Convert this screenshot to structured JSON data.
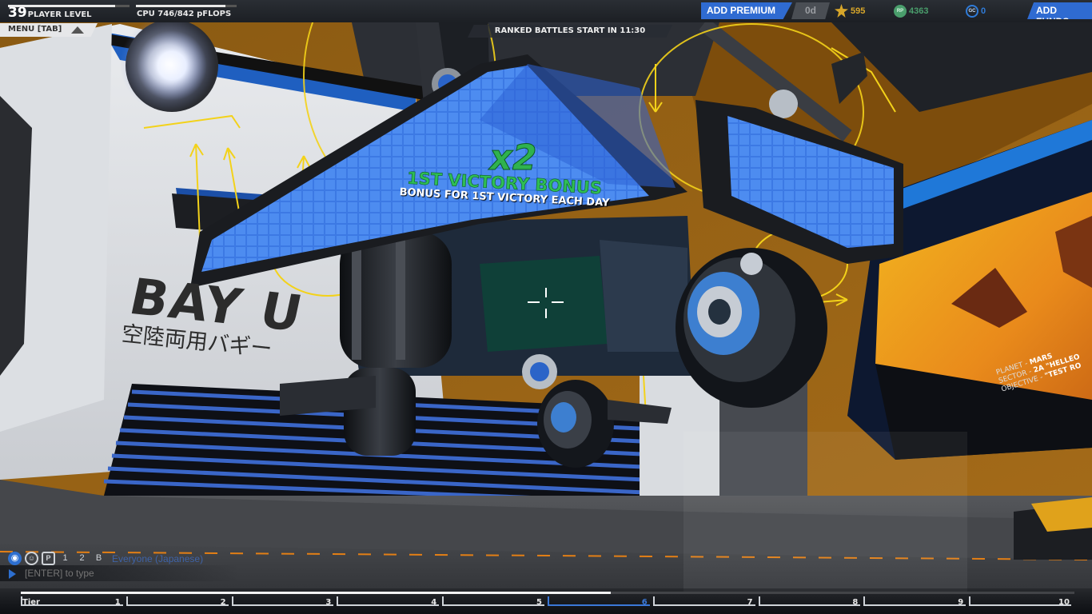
{
  "hud": {
    "player_level": "39",
    "player_level_label": "PLAYER LEVEL",
    "level_progress": 0.88,
    "cpu_label": "CPU 746/842 pFLOPS",
    "cpu_fraction": 0.886,
    "add_premium_label": "ADD PREMIUM",
    "premium_days": "0d",
    "tech_points": "595",
    "robits": "4363",
    "galaxy_coins": "0",
    "add_funds_label": "ADD FUNDS",
    "menu_label": "MENU [TAB]",
    "ranked_notice": "RANKED BATTLES START IN 11:30",
    "icons": {
      "tech_points": "star-icon",
      "robits": "rp-icon",
      "galaxy_coins": "gc-icon"
    },
    "colors": {
      "accent_blue": "#2f6bd1",
      "bonus_green": "#2fb24f",
      "tech_points": "#d7a62a",
      "robits": "#4a9e6c",
      "galaxy_coins": "#2f7bd8",
      "construction_arrows": "#f3d21a"
    }
  },
  "bonus": {
    "multiplier": "x2",
    "title": "1ST VICTORY BONUS",
    "subtitle": "BONUS FOR 1ST VICTORY EACH DAY"
  },
  "garage": {
    "bay_sign": "BAY",
    "bay_sign_fragment": "U",
    "japanese_caption": "空陸両用バギー",
    "planet_label": "PLANET -",
    "planet_value": "MARS",
    "sector_label": "SECTOR -",
    "sector_value": "2A \"HELLEO",
    "objective_label": "OBJECTIVE -",
    "objective_value": "\"TEST RO"
  },
  "chat": {
    "channel": "Everyone (Japanese)",
    "input_placeholder": "[ENTER] to type",
    "filters": [
      {
        "icon": "globe-icon",
        "glyph": "◉"
      },
      {
        "icon": "person-icon",
        "glyph": "☺"
      },
      {
        "icon": "party-icon",
        "glyph": "P"
      },
      {
        "icon": "friend-1-icon",
        "glyph": "1"
      },
      {
        "icon": "friend-2-icon",
        "glyph": "2"
      },
      {
        "icon": "clan-icon",
        "glyph": "B"
      }
    ]
  },
  "tiers": {
    "first_label": "Tier",
    "labels": [
      "1",
      "2",
      "3",
      "4",
      "5",
      "6",
      "7",
      "8",
      "9",
      "10"
    ],
    "active_tier": 6,
    "progress_fraction": 0.56
  }
}
